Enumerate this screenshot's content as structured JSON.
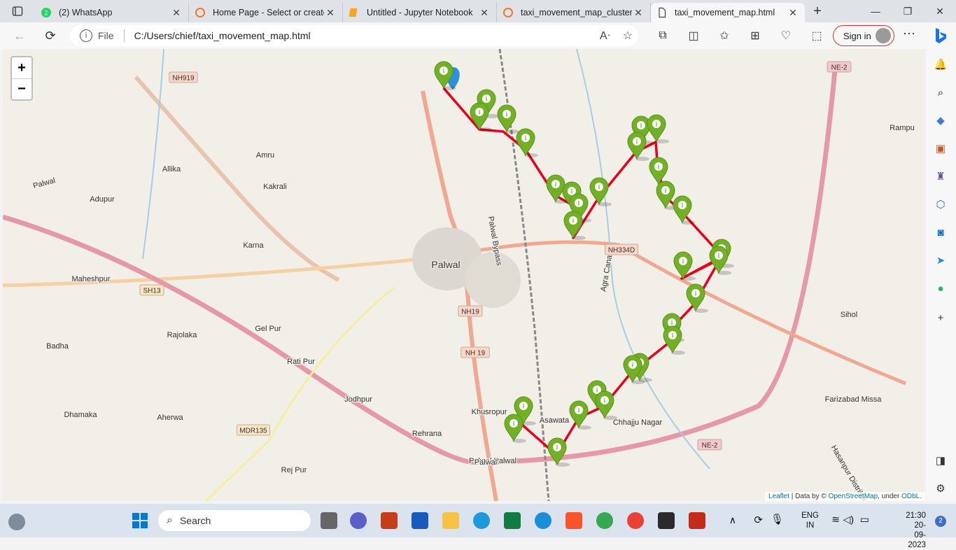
{
  "tabs": [
    {
      "title": "(2) WhatsApp",
      "badge": "2",
      "active": false
    },
    {
      "title": "Home Page - Select or create",
      "active": false
    },
    {
      "title": "Untitled - Jupyter Notebook",
      "active": false
    },
    {
      "title": "taxi_movement_map_clustere",
      "active": false
    },
    {
      "title": "taxi_movement_map.html",
      "active": true
    }
  ],
  "address": {
    "scheme": "File",
    "url": "C:/Users/chief/taxi_movement_map.html"
  },
  "signin_label": "Sign in",
  "map": {
    "zoom_in": "+",
    "zoom_out": "−",
    "attribution": {
      "leaflet": "Leaflet",
      "data": "| Data by ©",
      "osm": "OpenStreetMap",
      "under": ", under",
      "odbl": "ODbL."
    },
    "places": [
      {
        "name": "Palwal",
        "cls": "big"
      },
      {
        "name": "Amru"
      },
      {
        "name": "Allika"
      },
      {
        "name": "Kakrali"
      },
      {
        "name": "Adupur"
      },
      {
        "name": "Karna"
      },
      {
        "name": "Maheshpur"
      },
      {
        "name": "Gel Pur"
      },
      {
        "name": "Rajolaka"
      },
      {
        "name": "Badha"
      },
      {
        "name": "Rati Pur"
      },
      {
        "name": "Jodhpur"
      },
      {
        "name": "Dhamaka"
      },
      {
        "name": "Aherwa"
      },
      {
        "name": "Rehrana"
      },
      {
        "name": "Khusropur"
      },
      {
        "name": "Asawata"
      },
      {
        "name": "Chhajju Nagar"
      },
      {
        "name": "Rej Pur"
      },
      {
        "name": "Sihol"
      },
      {
        "name": "Farizabad Missa"
      },
      {
        "name": "Rampu"
      },
      {
        "name": "Palwal Bypass"
      },
      {
        "name": "Agra Canal"
      },
      {
        "name": "Hasanpur Distributory"
      },
      {
        "name": "Palwal"
      },
      {
        "name": "Palwal Palwal"
      },
      {
        "name": "Palwal"
      }
    ],
    "shields": [
      {
        "name": "NH919"
      },
      {
        "name": "NE-2"
      },
      {
        "name": "SH13"
      },
      {
        "name": "NH19"
      },
      {
        "name": "NH 19"
      },
      {
        "name": "NH334D"
      },
      {
        "name": "MDR135"
      },
      {
        "name": "NE-2"
      }
    ]
  },
  "taskbar": {
    "search": "Search",
    "lang": "ENG",
    "region": "IN",
    "time": "21:30",
    "date": "20-09-2023",
    "notif": "2"
  }
}
